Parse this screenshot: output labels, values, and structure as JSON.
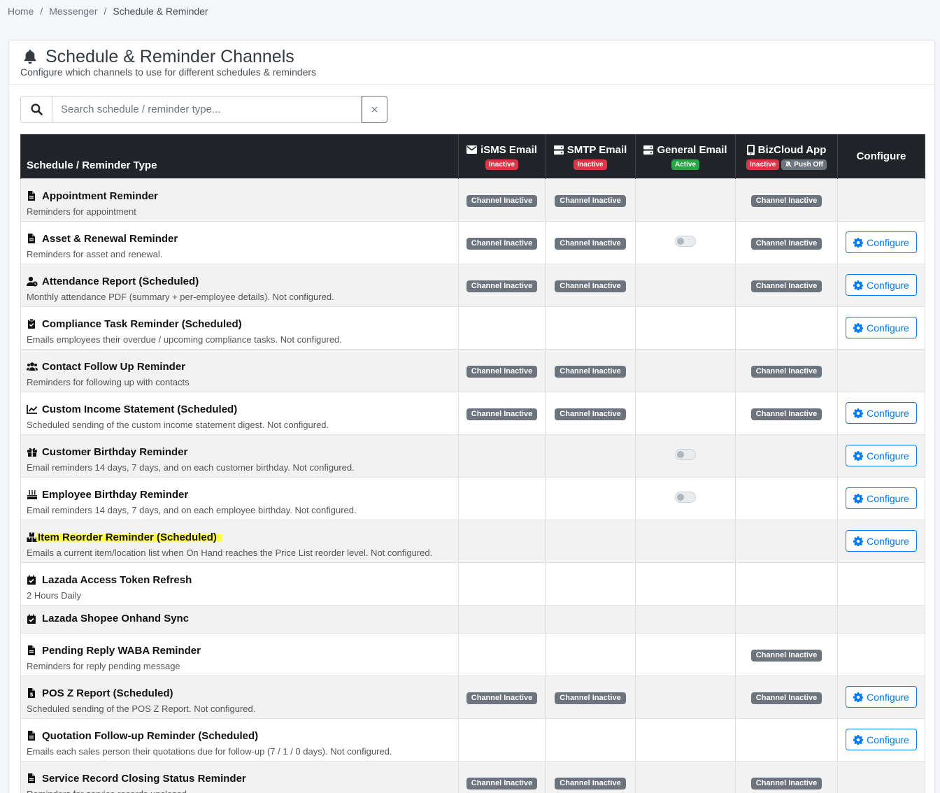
{
  "breadcrumb": {
    "home": "Home",
    "messenger": "Messenger",
    "current": "Schedule & Reminder"
  },
  "header": {
    "title": "Schedule & Reminder Channels",
    "subtitle": "Configure which channels to use for different schedules & reminders"
  },
  "search": {
    "placeholder": "Search schedule / reminder type...",
    "value": "",
    "clear": "×"
  },
  "columns": {
    "type": "Schedule / Reminder Type",
    "isms": {
      "name": "iSMS Email",
      "badge": "Inactive"
    },
    "smtp": {
      "name": "SMTP Email",
      "badge": "Inactive"
    },
    "general": {
      "name": "General Email",
      "badge": "Active"
    },
    "bizcloud": {
      "name": "BizCloud App",
      "badge": "Inactive",
      "push": "Push Off"
    },
    "configure": "Configure"
  },
  "labels": {
    "channel_inactive": "Channel Inactive",
    "configure": "Configure"
  },
  "colors": {
    "accent": "#007bff",
    "danger": "#dc3545",
    "success": "#28a745",
    "secondary": "#6c757d",
    "highlight": "#ffff3a"
  },
  "rows": [
    {
      "title": "Appointment Reminder",
      "desc": "Reminders for appointment",
      "icon": "file-icon"
    },
    {
      "title": "Asset & Renewal Reminder",
      "desc": "Reminders for asset and renewal.",
      "icon": "file-icon"
    },
    {
      "title": "Attendance Report (Scheduled)",
      "desc": "Monthly attendance PDF (summary + per-employee details). Not configured.",
      "icon": "user-clock-icon"
    },
    {
      "title": "Compliance Task Reminder (Scheduled)",
      "desc": "Emails employees their overdue / upcoming compliance tasks. Not configured.",
      "icon": "clipboard-check-icon"
    },
    {
      "title": "Contact Follow Up Reminder",
      "desc": "Reminders for following up with contacts",
      "icon": "users-icon"
    },
    {
      "title": "Custom Income Statement (Scheduled)",
      "desc": "Scheduled sending of the custom income statement digest. Not configured.",
      "icon": "chart-line-icon"
    },
    {
      "title": "Customer Birthday Reminder",
      "desc": "Email reminders 14 days, 7 days, and on each customer birthday. Not configured.",
      "icon": "gift-icon"
    },
    {
      "title": "Employee Birthday Reminder",
      "desc": "Email reminders 14 days, 7 days, and on each employee birthday. Not configured.",
      "icon": "birthday-cake-icon"
    },
    {
      "title": "Item Reorder Reminder (Scheduled)",
      "desc": "Emails a current item/location list when On Hand reaches the Price List reorder level. Not configured.",
      "icon": "boxes-icon"
    },
    {
      "title": "Lazada Access Token Refresh",
      "desc": "2 Hours Daily",
      "icon": "calendar-check-icon"
    },
    {
      "title": "Lazada Shopee Onhand Sync",
      "desc": "",
      "icon": "calendar-check-icon"
    },
    {
      "title": "Pending Reply WABA Reminder",
      "desc": "Reminders for reply pending message",
      "icon": "file-icon"
    },
    {
      "title": "POS Z Report (Scheduled)",
      "desc": "Scheduled sending of the POS Z Report. Not configured.",
      "icon": "file-invoice-icon"
    },
    {
      "title": "Quotation Follow-up Reminder (Scheduled)",
      "desc": "Emails each sales person their quotations due for follow-up (7 / 1 / 0 days). Not configured.",
      "icon": "file-icon"
    },
    {
      "title": "Service Record Closing Status Reminder",
      "desc": "Reminders for service records unclosed",
      "icon": "file-icon"
    }
  ]
}
